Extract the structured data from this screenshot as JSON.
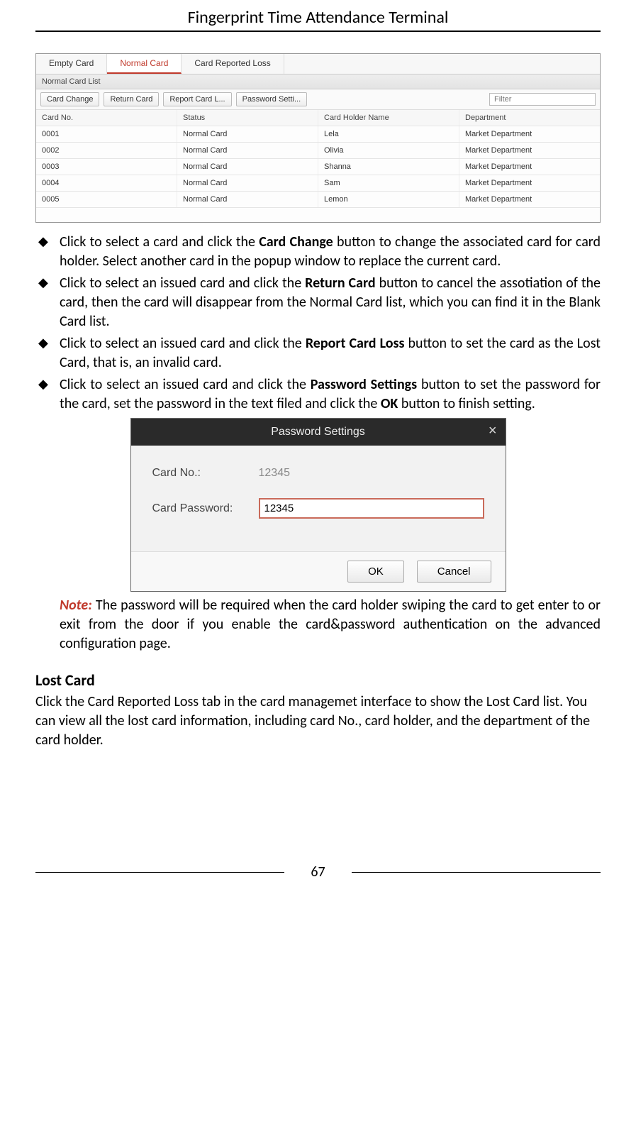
{
  "doc_title": "Fingerprint Time Attendance Terminal",
  "page_number": "67",
  "card_app": {
    "tabs": [
      "Empty Card",
      "Normal Card",
      "Card Reported Loss"
    ],
    "active_tab_index": 1,
    "section_label": "Normal Card List",
    "toolbar_buttons": [
      "Card Change",
      "Return Card",
      "Report Card L...",
      "Password Setti..."
    ],
    "filter_placeholder": "Filter",
    "columns": [
      "Card No.",
      "Status",
      "Card Holder Name",
      "Department"
    ],
    "rows": [
      [
        "0001",
        "Normal Card",
        "Lela",
        "Market Department"
      ],
      [
        "0002",
        "Normal Card",
        "Olivia",
        "Market Department"
      ],
      [
        "0003",
        "Normal Card",
        "Shanna",
        "Market Department"
      ],
      [
        "0004",
        "Normal Card",
        "Sam",
        "Market Department"
      ],
      [
        "0005",
        "Normal Card",
        "Lemon",
        "Market Department"
      ]
    ]
  },
  "bullets": {
    "b1_pre": "Click to select a card and click the ",
    "b1_bold": "Card Change",
    "b1_post": " button to change the associated card for card holder. Select another card in the popup window to replace the current card.",
    "b2_pre": "Click to select an issued card and click the ",
    "b2_bold": "Return Card",
    "b2_post": " button to cancel the assotiation of the card, then the card will disappear from the Normal Card list, which you can find it in the Blank Card list.",
    "b3_pre": "Click to select an issued card and click the ",
    "b3_bold": "Report Card Loss",
    "b3_post": " button to set the card as the Lost Card, that is, an invalid card.",
    "b4_pre": "Click to select an issued card and click the ",
    "b4_bold": "Password Settings",
    "b4_mid": " button to set the password for the card, set the password in the text filed and click the ",
    "b4_bold2": "OK",
    "b4_post": " button to finish setting."
  },
  "dialog": {
    "title": "Password Settings",
    "close": "×",
    "label_cardno": "Card No.:",
    "value_cardno": "12345",
    "label_pw": "Card Password:",
    "value_pw": "12345",
    "btn_ok": "OK",
    "btn_cancel": "Cancel"
  },
  "note": {
    "label": "Note:",
    "text": " The password will be required when the card holder swiping the card to get enter to or exit from the door if you enable the card&password authentication on the advanced configuration page."
  },
  "lost_card": {
    "heading": "Lost Card",
    "text": "Click the Card Reported Loss tab in the card managemet interface to show the Lost Card list. You can view all the lost card information, including card No., card holder, and the department of the card holder."
  }
}
